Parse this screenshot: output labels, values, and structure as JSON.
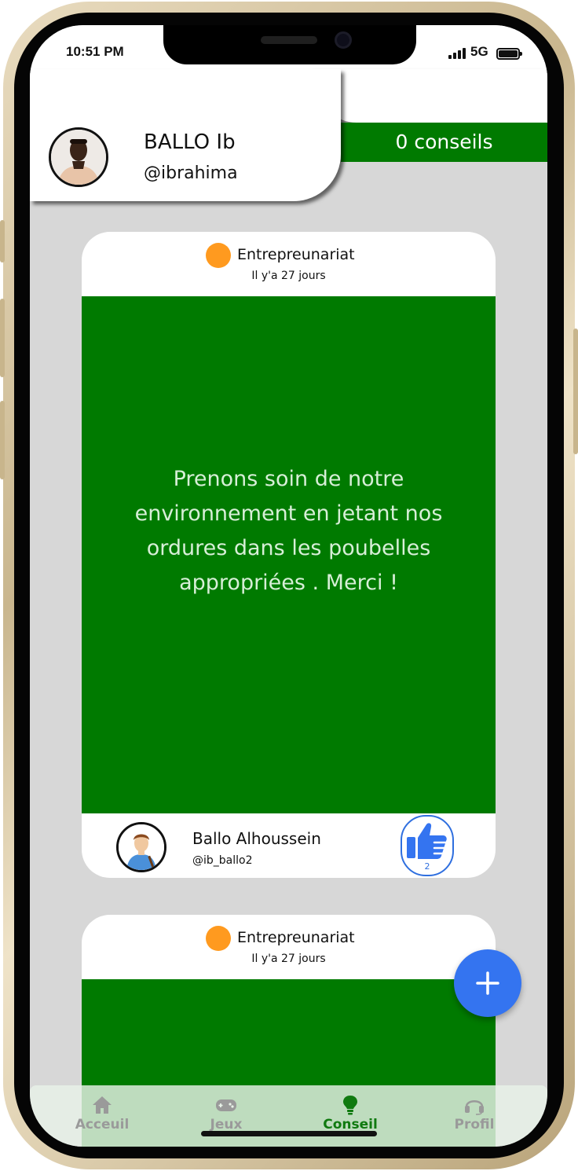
{
  "status_bar": {
    "time": "10:51 PM",
    "network": "5G"
  },
  "profile": {
    "name": "BALLO Ib",
    "handle": "@ibrahima",
    "tips_count_label": "0 conseils"
  },
  "posts": [
    {
      "category": "Entrepreunariat",
      "category_color": "#ff9a1f",
      "time_ago": "Il y'a 27 jours",
      "text": "Prenons soin de notre environnement en jetant nos ordures dans les poubelles appropriées . Merci !",
      "author_name": "Ballo Alhoussein",
      "author_handle": "@ib_ballo2",
      "likes": "2"
    },
    {
      "category": "Entrepreunariat",
      "category_color": "#ff9a1f",
      "time_ago": "Il y'a 27 jours"
    }
  ],
  "fab": {
    "label": "+"
  },
  "nav": {
    "items": [
      {
        "label": "Acceuil",
        "icon": "home-icon"
      },
      {
        "label": "Jeux",
        "icon": "gamepad-icon"
      },
      {
        "label": "Conseil",
        "icon": "lightbulb-icon",
        "active": true
      },
      {
        "label": "Profil",
        "icon": "headset-icon"
      }
    ]
  },
  "colors": {
    "brand_green": "#007a00",
    "accent_blue": "#3474f0",
    "category_orange": "#ff9a1f"
  }
}
